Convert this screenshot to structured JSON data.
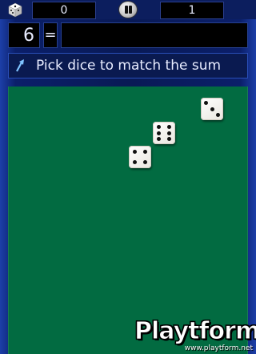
{
  "scores": {
    "left": "0",
    "right": "1"
  },
  "sum": {
    "target": "6",
    "equals": "="
  },
  "instruction": {
    "text": "Pick dice to match the sum"
  },
  "dice": [
    {
      "value": 3
    },
    {
      "value": 6
    },
    {
      "value": 4
    }
  ],
  "watermark": {
    "brand": "Playtform",
    "url": "www.playtform.net"
  },
  "colors": {
    "table": "#026b41",
    "frame": "#091a55",
    "accent_border": "#26408f"
  },
  "icons": {
    "logo": "die-logo-icon",
    "pause": "pause-icon",
    "instruction": "arrow-icon"
  }
}
